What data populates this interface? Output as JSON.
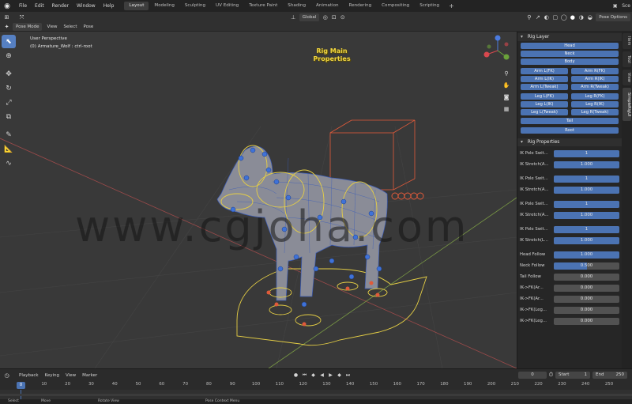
{
  "topbar": {
    "menus": [
      "File",
      "Edit",
      "Render",
      "Window",
      "Help"
    ],
    "workspaces": [
      {
        "label": "Layout",
        "active": true
      },
      {
        "label": "Modeling",
        "active": false
      },
      {
        "label": "Sculpting",
        "active": false
      },
      {
        "label": "UV Editing",
        "active": false
      },
      {
        "label": "Texture Paint",
        "active": false
      },
      {
        "label": "Shading",
        "active": false
      },
      {
        "label": "Animation",
        "active": false
      },
      {
        "label": "Rendering",
        "active": false
      },
      {
        "label": "Compositing",
        "active": false
      },
      {
        "label": "Scripting",
        "active": false
      }
    ],
    "add_workspace": "+",
    "scene_label": "Sce"
  },
  "viewport_header": {
    "transform_orientation": "Global",
    "pose_options": "Pose Options",
    "mode": "Pose Mode",
    "menus": [
      "View",
      "Select",
      "Pose"
    ]
  },
  "viewport": {
    "view_name": "User Perspective",
    "active_object": "(0) Armature_Wolf : ctrl-root",
    "overlay_title_line1": "Rig Main",
    "overlay_title_line2": "Properties",
    "watermark": "www.cgjoha.com",
    "tools": [
      "select-icon",
      "cursor-icon",
      "move-icon",
      "rotate-icon",
      "scale-icon",
      "transform-icon",
      "annotate-icon",
      "measure-icon",
      "relax-icon"
    ]
  },
  "npanel": {
    "rig_layer_title": "Rig Layer",
    "layers_full": [
      "Head",
      "Neck",
      "Body"
    ],
    "layer_rows": [
      [
        "Arm L(FK)",
        "Arm R(FK)"
      ],
      [
        "Arm L(IK)",
        "Arm R(IK)"
      ],
      [
        "Arm L(Tweak)",
        "Arm R(Tweak)"
      ],
      [
        "Leg L(FK)",
        "Leg R(FK)"
      ],
      [
        "Leg L(IK)",
        "Leg R(IK)"
      ],
      [
        "Leg L(Tweak)",
        "Leg R(Tweak)"
      ]
    ],
    "layers_tail": [
      "Tail",
      "Root"
    ],
    "rig_properties_title": "Rig Properties",
    "ik_groups": [
      [
        {
          "label": "IK Pole Swit...",
          "value": "1",
          "fill": 1.0
        },
        {
          "label": "IK Stretch(A...",
          "value": "1.000",
          "fill": 1.0
        }
      ],
      [
        {
          "label": "IK Pole Swit...",
          "value": "1",
          "fill": 1.0
        },
        {
          "label": "IK Stretch(A...",
          "value": "1.000",
          "fill": 1.0
        }
      ],
      [
        {
          "label": "IK Pole Swit...",
          "value": "1",
          "fill": 1.0
        },
        {
          "label": "IK Stretch(A...",
          "value": "1.000",
          "fill": 1.0
        }
      ],
      [
        {
          "label": "IK Pole Swit...",
          "value": "1",
          "fill": 1.0
        },
        {
          "label": "IK Stretch(L...",
          "value": "1.000",
          "fill": 1.0
        }
      ]
    ],
    "follow_props": [
      {
        "label": "Head Follow",
        "value": "1.000",
        "fill": 1.0
      },
      {
        "label": "Neck Follow",
        "value": "0.500",
        "fill": 0.5
      },
      {
        "label": "Tail Follow",
        "value": "0.000",
        "fill": 0.0
      },
      {
        "label": "IK->FK(Ar...",
        "value": "0.000",
        "fill": 0.0
      },
      {
        "label": "IK->FK(Ar...",
        "value": "0.000",
        "fill": 0.0
      },
      {
        "label": "IK->FK(Leg...",
        "value": "0.000",
        "fill": 0.0
      },
      {
        "label": "IK->FK(Leg...",
        "value": "0.000",
        "fill": 0.0
      }
    ],
    "side_tabs": [
      {
        "label": "Item",
        "active": false
      },
      {
        "label": "Tool",
        "active": false
      },
      {
        "label": "View",
        "active": false
      },
      {
        "label": "SimpleRigUI",
        "active": true
      }
    ]
  },
  "timeline": {
    "menus": [
      "Playback",
      "Keying",
      "View",
      "Marker"
    ],
    "current_frame": "0",
    "start_label": "Start",
    "start_value": "1",
    "end_label": "End",
    "end_value": "250",
    "playhead_label": "0",
    "ticks": [
      "0",
      "10",
      "20",
      "30",
      "40",
      "50",
      "60",
      "70",
      "80",
      "90",
      "100",
      "110",
      "120",
      "130",
      "140",
      "150",
      "160",
      "170",
      "180",
      "190",
      "200",
      "210",
      "220",
      "230",
      "240",
      "250"
    ]
  },
  "statusbar": {
    "items": [
      "Select",
      "Move",
      "Rotate View",
      "Pose Context Menu"
    ]
  },
  "colors": {
    "accent": "#4b73b3",
    "rig_title": "#f0d540",
    "bone_blue": "#3f72d8",
    "ctrl_yellow": "#e6cf45",
    "ctrl_red": "#e05a3a"
  }
}
